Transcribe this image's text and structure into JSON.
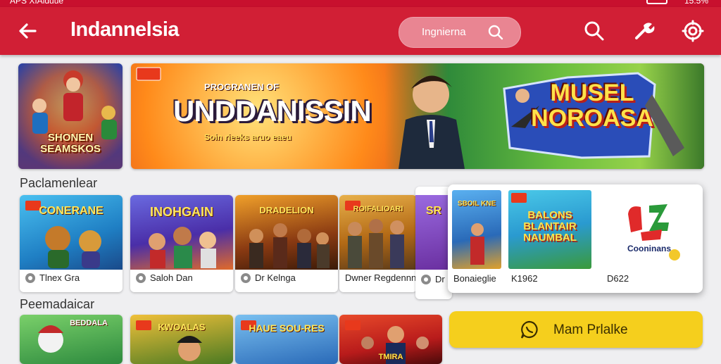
{
  "status_bar": {
    "left_text": "APS XIAiduue",
    "right_text": "15.5%"
  },
  "app_bar": {
    "title": "Indannelsia",
    "search_placeholder": "Ingnierna",
    "actions": [
      "search-icon",
      "wrench-icon",
      "settings-icon"
    ]
  },
  "banners": [
    {
      "art_text": "SHONEN\nSEAMSKOS"
    },
    {
      "kicker": "PROGRANEN OF",
      "headline": "UNDDANISSIN",
      "sub": "Soin rieeks aruo eaeu",
      "right_title": "MUSEL\nNOROASA"
    }
  ],
  "sections": [
    {
      "title": "Paclamenlear",
      "cards": [
        {
          "art": "CONERANE",
          "caption": "Tlnex Gra",
          "accent": "#1f7fc4"
        },
        {
          "art": "INOHGAIN",
          "caption": "Saloh Dan",
          "accent": "#4a2ea8"
        },
        {
          "art": "DRADELION",
          "caption": "Dr Kelnga",
          "accent": "#8a3a12"
        },
        {
          "art": "ROIFALIOARI",
          "caption": "Dwner Regdennn",
          "accent": "#b36a16"
        },
        {
          "art": "SR",
          "caption": "Dr",
          "accent": "#6a2fa0"
        }
      ]
    },
    {
      "title": "Peemadaicar",
      "cards": [
        {
          "art": "BEDDALA",
          "accent": "#2d8a3e"
        },
        {
          "art": "KWOALAS",
          "accent": "#4b7a22"
        },
        {
          "art": "HAUE SOU-RES",
          "accent": "#2a6ab8"
        },
        {
          "art": "TMIRA",
          "accent": "#b81b1b"
        }
      ]
    }
  ],
  "popup": {
    "items": [
      {
        "art": "SBOIL KNE",
        "caption": "Bonaieglie"
      },
      {
        "art": "BALONS BLANTAIR NAUMBAL",
        "caption": "K1962"
      },
      {
        "art": "Cooninans",
        "caption": "D622"
      }
    ]
  },
  "cta": {
    "label": "Mam Prlalke"
  },
  "colors": {
    "primary": "#d11f35",
    "cta": "#f5cf1d"
  }
}
